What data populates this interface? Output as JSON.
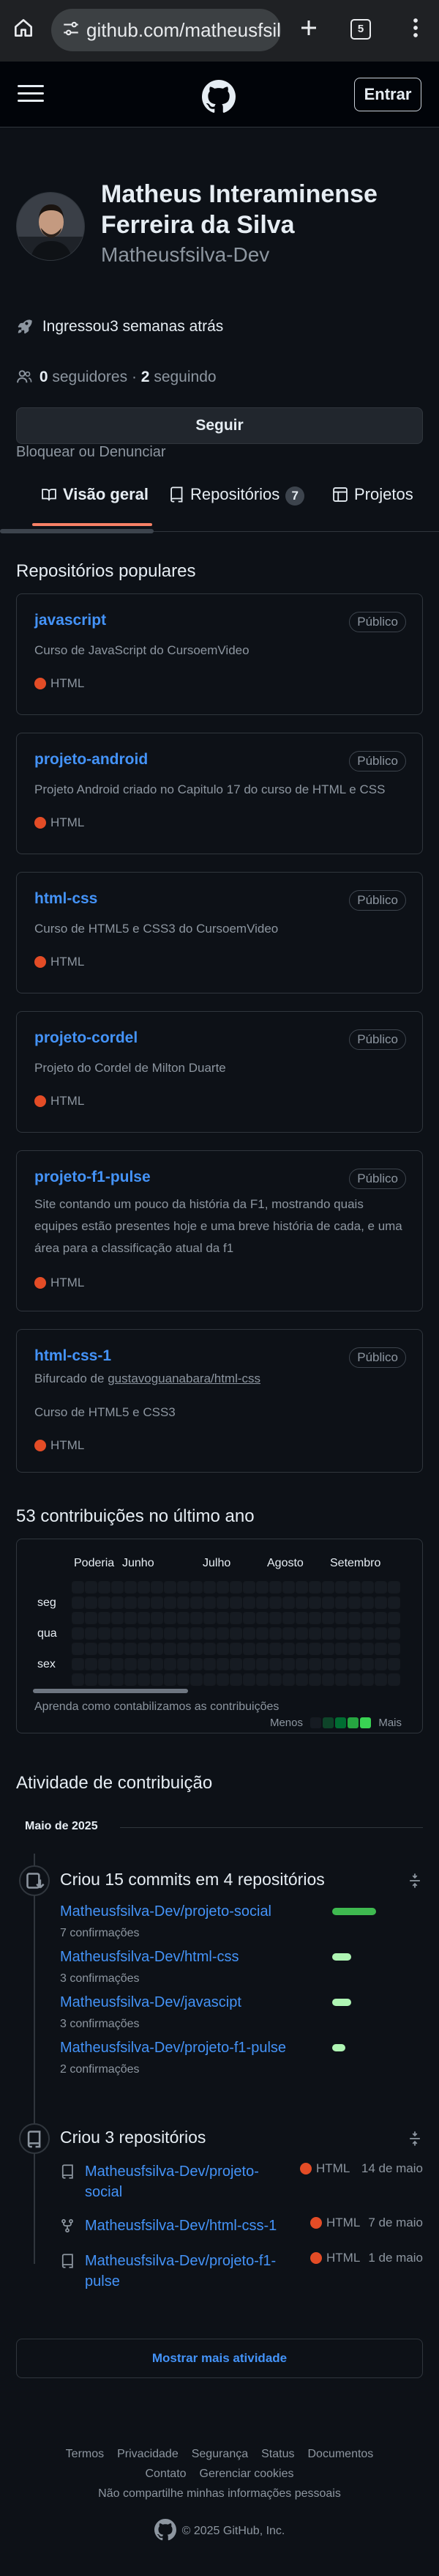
{
  "browser": {
    "url": "github.com/matheusfsilv",
    "tab_count": "5"
  },
  "header": {
    "sign_in": "Entrar"
  },
  "profile": {
    "full_name": "Matheus Interaminense Ferreira da Silva",
    "username": "Matheusfsilva-Dev",
    "joined": "Ingressou3 semanas atrás",
    "followers_count": "0",
    "followers_label": "seguidores",
    "following_count": "2",
    "following_label": "seguindo",
    "follow_button": "Seguir",
    "block_report": "Bloquear ou Denunciar"
  },
  "tabs": [
    {
      "label": "Visão geral"
    },
    {
      "label": "Repositórios",
      "count": "7"
    },
    {
      "label": "Projetos"
    }
  ],
  "popular": {
    "title": "Repositórios populares",
    "repos": [
      {
        "name": "javascript",
        "visibility": "Público",
        "description": "Curso de JavaScript do CursoemVideo",
        "language": "HTML"
      },
      {
        "name": "projeto-android",
        "visibility": "Público",
        "description": "Projeto Android criado no Capitulo 17 do curso de HTML e CSS",
        "language": "HTML"
      },
      {
        "name": "html-css",
        "visibility": "Público",
        "description": "Curso de HTML5 e CSS3 do CursoemVideo",
        "language": "HTML"
      },
      {
        "name": "projeto-cordel",
        "visibility": "Público",
        "description": "Projeto do Cordel de Milton Duarte",
        "language": "HTML"
      },
      {
        "name": "projeto-f1-pulse",
        "visibility": "Público",
        "description": "Site contando um pouco da história da F1, mostrando quais equipes estão presentes hoje e uma breve história de cada, e uma área para a classificação atual da f1",
        "language": "HTML"
      },
      {
        "name": "html-css-1",
        "visibility": "Público",
        "forked_prefix": "Bifurcado de",
        "forked_from": "gustavoguanabara/html-css",
        "description": "Curso de HTML5 e CSS3",
        "language": "HTML"
      }
    ],
    "language_color": "#e34c26"
  },
  "contributions": {
    "title": "53 contribuições no último ano",
    "months": [
      "Poderia",
      "Junho",
      "Julho",
      "Agosto",
      "Setembro"
    ],
    "days": [
      "seg",
      "qua",
      "sex"
    ],
    "learn": "Aprenda como contabilizamos as contribuições",
    "less": "Menos",
    "more": "Mais",
    "legend_colors": [
      "#161b22",
      "#0e4429",
      "#006d32",
      "#26a641",
      "#39d353"
    ]
  },
  "activity": {
    "title": "Atividade de contribuição",
    "month": "Maio de 2025",
    "commits": {
      "heading": "Criou 15 commits em 4 repositórios",
      "items": [
        {
          "repo": "Matheusfsilva-Dev/projeto-social",
          "count": "7 confirmações",
          "fraction": 1.0
        },
        {
          "repo": "Matheusfsilva-Dev/html-css",
          "count": "3 confirmações",
          "fraction": 0.43
        },
        {
          "repo": "Matheusfsilva-Dev/javascipt",
          "count": "3 confirmações",
          "fraction": 0.43
        },
        {
          "repo": "Matheusfsilva-Dev/projeto-f1-pulse",
          "count": "2 confirmações",
          "fraction": 0.29
        }
      ]
    },
    "created": {
      "heading": "Criou 3 repositórios",
      "items": [
        {
          "repo": "Matheusfsilva-Dev/projeto-social",
          "language": "HTML",
          "date": "14 de maio",
          "icon": "repo-icon"
        },
        {
          "repo": "Matheusfsilva-Dev/html-css-1",
          "language": "HTML",
          "date": "7 de maio",
          "icon": "fork-icon"
        },
        {
          "repo": "Matheusfsilva-Dev/projeto-f1-pulse",
          "language": "HTML",
          "date": "1 de maio",
          "icon": "repo-icon"
        }
      ]
    },
    "show_more": "Mostrar mais atividade"
  },
  "footer": {
    "links_row1": [
      "Termos",
      "Privacidade",
      "Segurança",
      "Status",
      "Documentos"
    ],
    "links_row2": [
      "Contato",
      "Gerenciar cookies"
    ],
    "links_row3": [
      "Não compartilhe minhas informações pessoais"
    ],
    "copyright": "© 2025 GitHub, Inc."
  }
}
